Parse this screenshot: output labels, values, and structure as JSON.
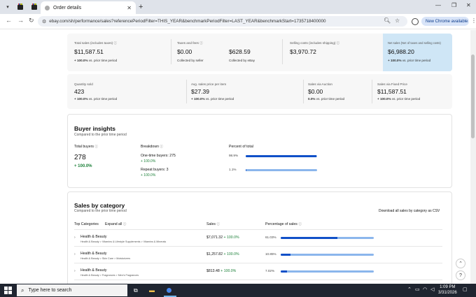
{
  "browser": {
    "tab_title": "Order details",
    "url": "ebay.com/sh/performance/sales?referencePeriodFilter=THIS_YEAR&benchmarkPeriodFilter=LAST_YEAR&benchmarkStart=1735718400000",
    "update_label": "New Chrome available"
  },
  "summary": {
    "total_sales": {
      "label": "Total sales (includes taxes)",
      "value": "$11,587.51",
      "change": "+ 100.0%",
      "period": "vs. prior time period"
    },
    "taxes_fees": {
      "label": "Taxes and fees",
      "seller_value": "$0.00",
      "seller_caption": "Collected by seller",
      "ebay_value": "$628.59",
      "ebay_caption": "Collected by eBay"
    },
    "selling_costs": {
      "label": "Selling costs (includes shipping)",
      "value": "$3,970.72"
    },
    "net_sales": {
      "label": "Net sales (Net of taxes and selling costs)",
      "value": "$6,988.20",
      "change": "+ 100.0%",
      "period": "vs. prior time period"
    }
  },
  "stats": [
    {
      "label": "Quantity sold",
      "value": "423",
      "change": "+ 100.0%",
      "period": "vs. prior time period"
    },
    {
      "label": "Avg. sales price per item",
      "value": "$27.39",
      "change": "+ 100.0%",
      "period": "vs. prior time period"
    },
    {
      "label": "Sales via Auction",
      "value": "$0.00",
      "change": "0.0%",
      "period": "vs. prior time period"
    },
    {
      "label": "Sales via Fixed Price",
      "value": "$11,587.51",
      "change": "+ 100.0%",
      "period": "vs. prior time period"
    }
  ],
  "buyer_insights": {
    "title": "Buyer insights",
    "subtitle": "Compared to the prior time period",
    "buyers_label": "Total buyers",
    "buyers_value": "278",
    "buyers_change": "+ 100.0%",
    "breakdown_label": "Breakdown",
    "percent_label": "Percent of total",
    "rows": [
      {
        "label": "One-time buyers: 275",
        "change": "+ 100.0%",
        "percent": "98.9%",
        "fraction": 0.989
      },
      {
        "label": "Repeat buyers: 3",
        "change": "+ 100.0%",
        "percent": "1.1%",
        "fraction": 0.011
      }
    ]
  },
  "sales_by_category": {
    "title": "Sales by category",
    "subtitle": "Compared to the prior time period",
    "download_label": "Download all sales by category as CSV",
    "col_categories": "Top Categories",
    "expand_all": "Expand all",
    "col_sales": "Sales",
    "col_percentage": "Percentage of sales",
    "rows": [
      {
        "name": "Health & Beauty",
        "path": "Health & Beauty > Vitamins & Lifestyle Supplements > Vitamins & Minerals",
        "sales": "$7,071.32",
        "change": "+ 100.0%",
        "percent": "61.03%",
        "fraction": 0.6103
      },
      {
        "name": "Health & Beauty",
        "path": "Health & Beauty > Skin Care > Moisturizers",
        "sales": "$1,257.82",
        "change": "+ 100.0%",
        "percent": "10.85%",
        "fraction": 0.1085
      },
      {
        "name": "Health & Beauty",
        "path": "Health & Beauty > Fragrances > Men's Fragrances",
        "sales": "$813.48",
        "change": "+ 100.0%",
        "percent": "7.02%",
        "fraction": 0.0702
      }
    ]
  },
  "taskbar": {
    "search_placeholder": "Type here to search",
    "time": "1:09 PM",
    "date": "3/31/2026"
  }
}
